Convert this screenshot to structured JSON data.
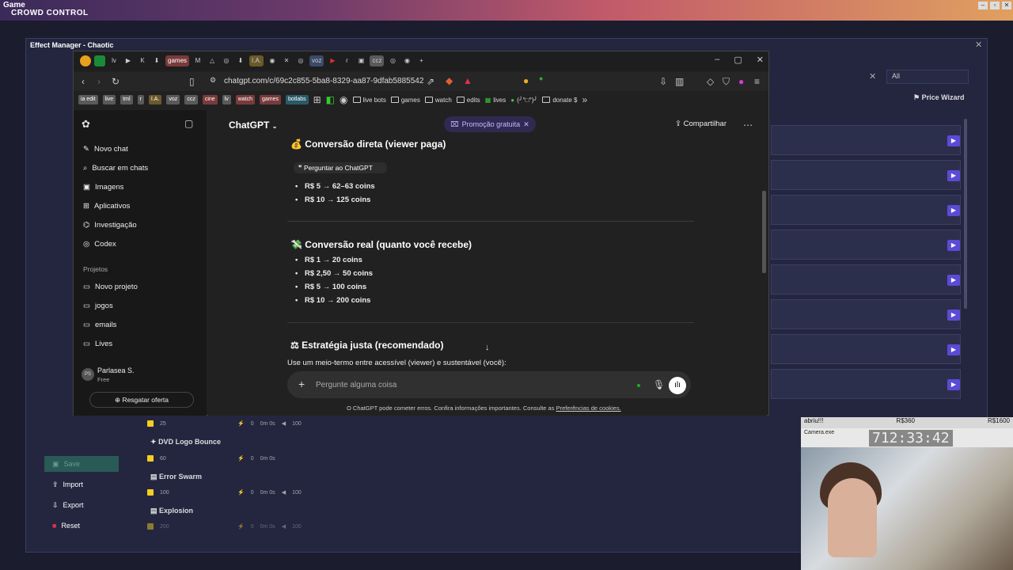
{
  "os": {
    "game_label": "Game",
    "app_logo": "CROWD CONTROL"
  },
  "bg_app": {
    "window_title": "Effect Manager - Chaotic",
    "filter_value": "All",
    "price_wizard": "Price Wizard",
    "save": "Save",
    "import": "Import",
    "export": "Export",
    "reset": "Reset",
    "effects": [
      {
        "name": "DVD Logo Bounce",
        "price": "60",
        "qty": "0",
        "dur": "0m 0s",
        "vol": ""
      },
      {
        "name": "Error Swarm",
        "price": "100",
        "qty": "0",
        "dur": "0m 0s",
        "vol": "100"
      },
      {
        "name": "Explosion",
        "price": "200",
        "qty": "0",
        "dur": "0m 0s",
        "vol": "100"
      }
    ],
    "row0": {
      "price": "25",
      "qty": "0",
      "dur": "0m 0s",
      "vol": "100"
    }
  },
  "browser": {
    "tabs": [
      "lv",
      "games",
      "I.A.",
      "voz",
      "r",
      "ccz"
    ],
    "url": "chatgpt.com/c/69c2c855-5ba8-8329-aa87-9dfab5885542",
    "bookmarks": [
      "ia edit",
      "live",
      "tml",
      "r",
      "I.A.",
      "voz",
      "ccz",
      "cine",
      "lv",
      "watch",
      "games",
      "botlabs"
    ],
    "folders": [
      "live bots",
      "games",
      "watch",
      "edits",
      "lives",
      "(╯°□°)╯",
      "donate $"
    ]
  },
  "chatgpt": {
    "sidebar": [
      "Novo chat",
      "Buscar em chats",
      "Imagens",
      "Aplicativos",
      "Investigação",
      "Codex"
    ],
    "projects_label": "Projetos",
    "projects": [
      "Novo projeto",
      "jogos",
      "emails",
      "Lives"
    ],
    "user_name": "Parlasea S.",
    "user_plan": "Free",
    "user_initials": "PS",
    "upgrade": "Resgatar oferta",
    "model": "ChatGPT",
    "promo": "Promoção gratuita",
    "share": "Compartilhar",
    "tooltip": "Perguntar ao ChatGPT",
    "sec1_title": "Conversão direta (viewer paga)",
    "sec1_items": [
      "R$ 5 → 62–63 coins",
      "R$ 10 → 125 coins"
    ],
    "sec2_title": "Conversão real (quanto você recebe)",
    "sec2_items": [
      "R$ 1 → 20 coins",
      "R$ 2,50 → 50 coins",
      "R$ 5 → 100 coins",
      "R$ 10 → 200 coins"
    ],
    "sec3_title": "Estratégia justa (recomendado)",
    "sec3_text": "Use um meio-termo entre acessível (viewer) e sustentável (você):",
    "placeholder": "Pergunte alguma coisa",
    "disclaimer": "O ChatGPT pode cometer erros. Confira informações importantes. Consulte as ",
    "disclaimer_link": "Preferências de cookies."
  },
  "overlay": {
    "left": "abriu!!!",
    "mid": "R$360",
    "right": "R$1600",
    "cam_title": "Camera.exe",
    "timer": "712:33:42"
  }
}
